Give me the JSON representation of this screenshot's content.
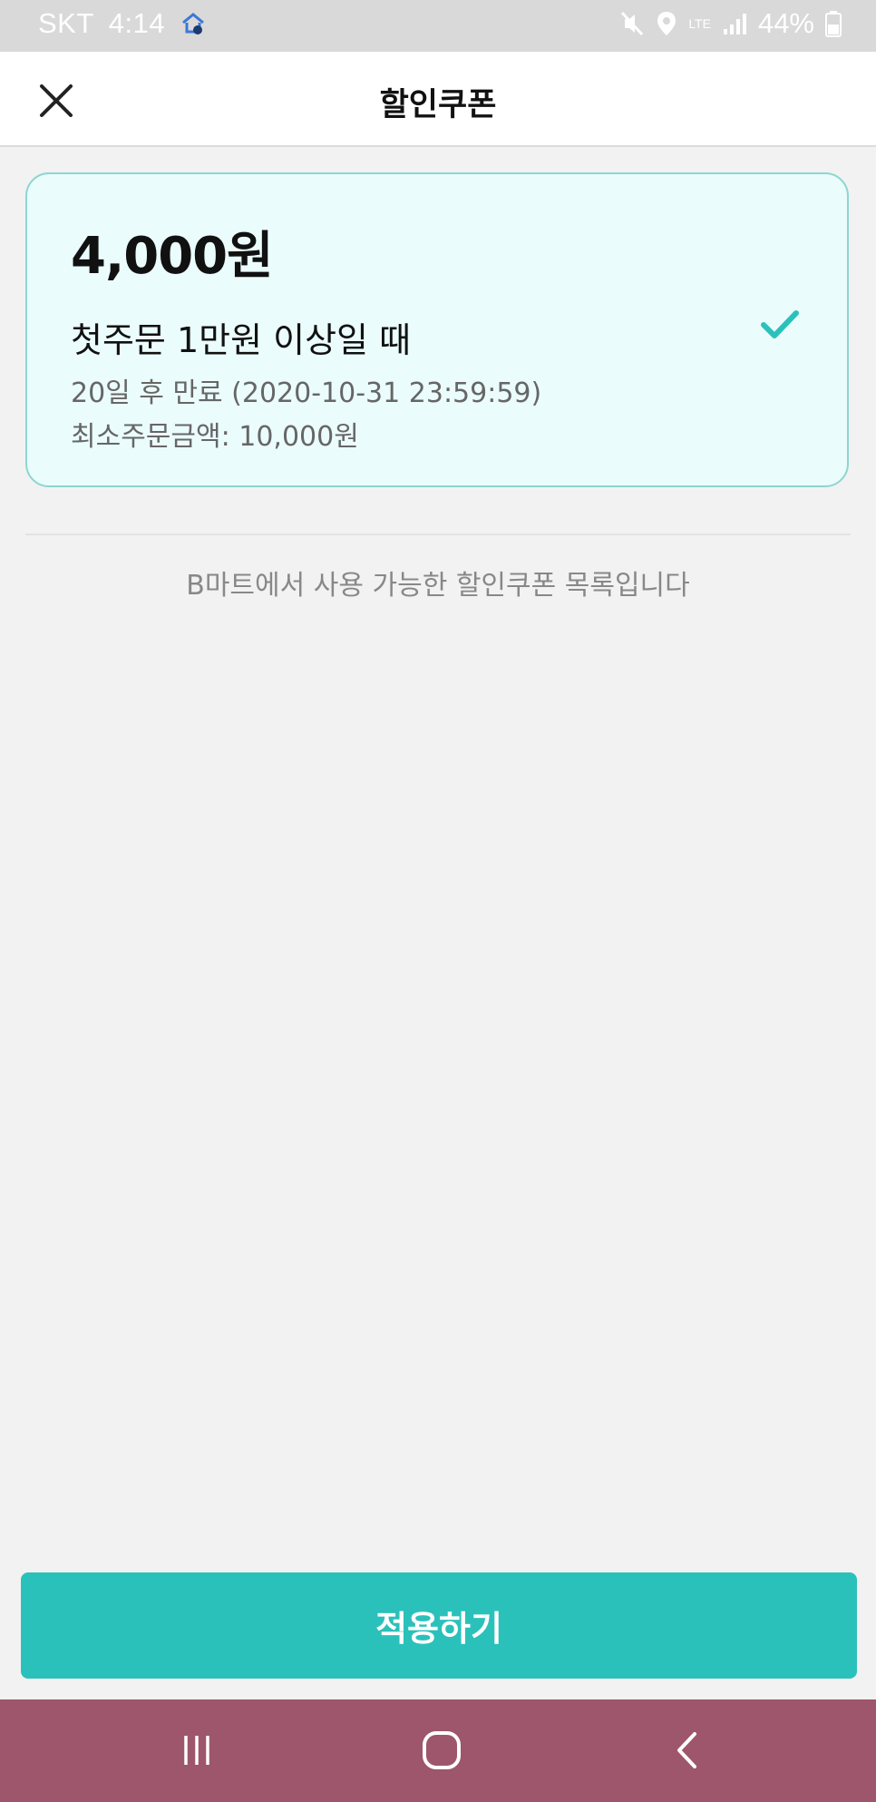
{
  "status_bar": {
    "carrier": "SKT",
    "time": "4:14",
    "network": "LTE",
    "battery": "44%",
    "icons": [
      "home-sync-icon",
      "mute-icon",
      "location-icon",
      "lte-icon",
      "signal-icon",
      "battery-icon"
    ]
  },
  "header": {
    "title": "할인쿠폰",
    "close_icon": "close-icon"
  },
  "coupon": {
    "amount": "4,000원",
    "condition": "첫주문 1만원 이상일 때",
    "expiry": "20일 후 만료 (2020-10-31 23:59:59)",
    "min_order": "최소주문금액: 10,000원",
    "selected": true,
    "check_icon": "checkmark-icon"
  },
  "notice": "B마트에서 사용 가능한 할인쿠폰 목록입니다",
  "apply_button": "적용하기",
  "nav_bar": {
    "icons": [
      "recent-apps-icon",
      "home-icon",
      "back-icon"
    ]
  },
  "colors": {
    "accent": "#2bc1bb",
    "coupon_bg": "#ebfcfc",
    "coupon_border": "#8dd6d0",
    "nav_bar": "#9d566c",
    "background": "#f2f2f2"
  }
}
